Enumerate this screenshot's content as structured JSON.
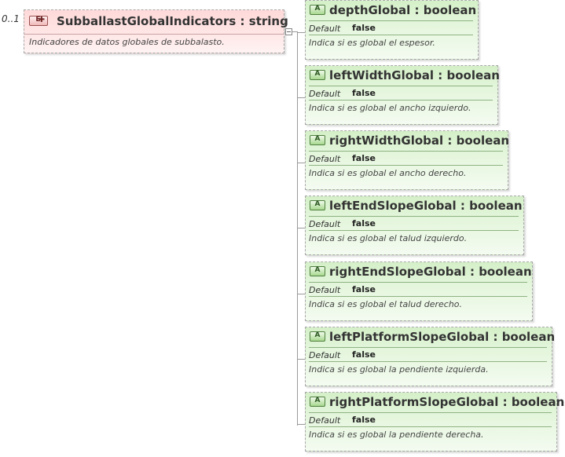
{
  "element": {
    "occurrence": "0..1",
    "icon": "element-icon",
    "icon_text": "E",
    "name": "SubballastGlobalIndicators",
    "separator": ":",
    "type": "string",
    "documentation": "Indicadores de datos globales de subbalasto."
  },
  "attributes": [
    {
      "icon_text": "A",
      "name": "depthGlobal",
      "separator": ":",
      "type": "boolean",
      "default_label": "Default",
      "default_value": "false",
      "documentation": "Indica si es global el espesor."
    },
    {
      "icon_text": "A",
      "name": "leftWidthGlobal",
      "separator": ":",
      "type": "boolean",
      "default_label": "Default",
      "default_value": "false",
      "documentation": "Indica si es global el ancho izquierdo."
    },
    {
      "icon_text": "A",
      "name": "rightWidthGlobal",
      "separator": ":",
      "type": "boolean",
      "default_label": "Default",
      "default_value": "false",
      "documentation": "Indica si es global el ancho derecho."
    },
    {
      "icon_text": "A",
      "name": "leftEndSlopeGlobal",
      "separator": ":",
      "type": "boolean",
      "default_label": "Default",
      "default_value": "false",
      "documentation": "Indica si es global el talud izquierdo."
    },
    {
      "icon_text": "A",
      "name": "rightEndSlopeGlobal",
      "separator": ":",
      "type": "boolean",
      "default_label": "Default",
      "default_value": "false",
      "documentation": "Indica si es global el talud derecho."
    },
    {
      "icon_text": "A",
      "name": "leftPlatformSlopeGlobal",
      "separator": ":",
      "type": "boolean",
      "default_label": "Default",
      "default_value": "false",
      "documentation": "Indica si es global la pendiente izquierda."
    },
    {
      "icon_text": "A",
      "name": "rightPlatformSlopeGlobal",
      "separator": ":",
      "type": "boolean",
      "default_label": "Default",
      "default_value": "false",
      "documentation": "Indica si es global la pendiente derecha."
    }
  ],
  "colors": {
    "element_fill": "#ffe0e0",
    "attribute_fill": "#dff3d6",
    "border": "#a8a8a8"
  }
}
